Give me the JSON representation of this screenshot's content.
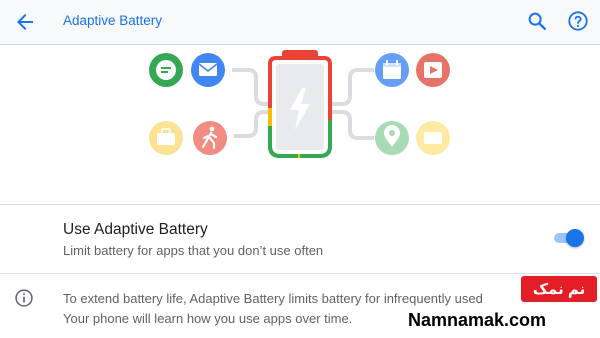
{
  "appbar": {
    "title": "Adaptive Battery",
    "back_icon": "arrow-back-icon",
    "search_icon": "search-icon",
    "help_icon": "help-icon"
  },
  "illustration": {
    "left_apps": [
      "messages-icon",
      "email-icon",
      "briefcase-icon",
      "walking-person-icon"
    ],
    "right_apps": [
      "calendar-icon",
      "play-icon",
      "location-pin-icon",
      "folder-icon"
    ],
    "battery": "battery-charging-icon"
  },
  "setting": {
    "title": "Use Adaptive Battery",
    "summary": "Limit battery for apps that you don’t use often",
    "enabled": true
  },
  "footer": {
    "line1": "To extend battery life, Adaptive Battery limits battery for infrequently used",
    "line2": "Your phone will learn how you use apps over time."
  },
  "watermark": {
    "badge_text": "نم نمک",
    "site": "Namnamak.com"
  },
  "colors": {
    "accent": "#1a73e8",
    "toggle_track": "#9ec3f7",
    "battery_red": "#ea4335",
    "battery_yellow": "#fbbc04",
    "battery_green": "#34a853",
    "watermark_red": "#e41e26"
  }
}
